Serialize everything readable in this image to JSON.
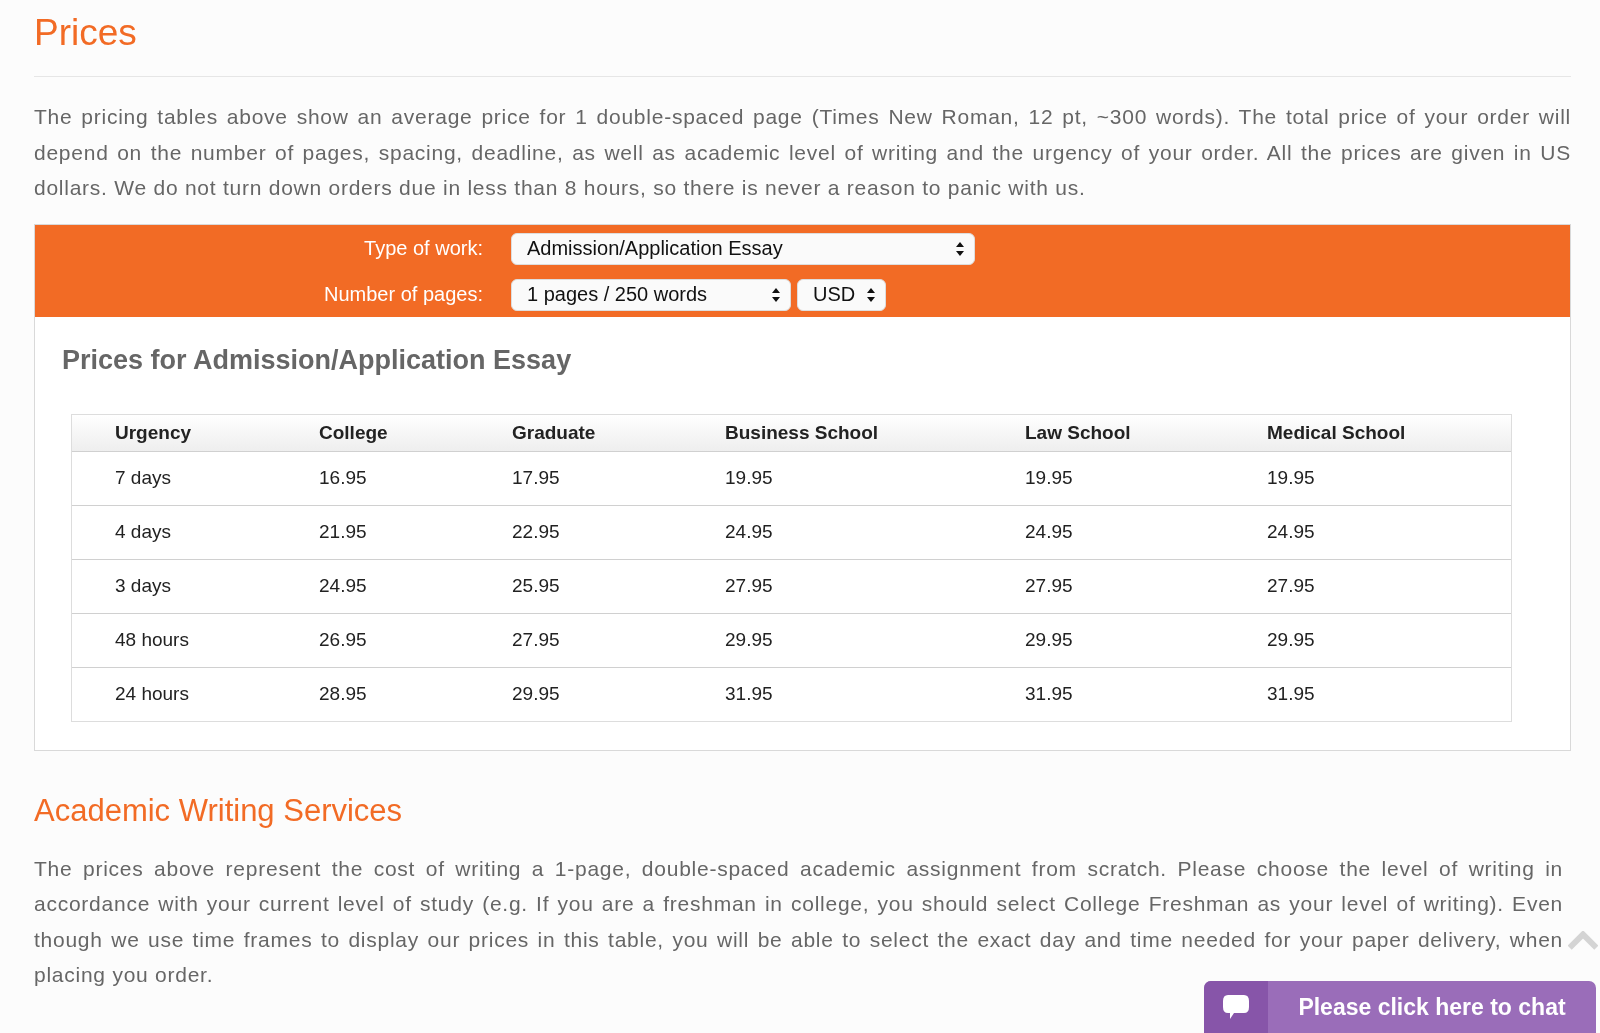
{
  "title": "Prices",
  "intro": "The pricing tables above show an average price for 1 double-spaced page (Times New Roman, 12 pt, ~300 words). The total price of your order will depend on the number of pages, spacing, deadline, as well as academic level of writing and the urgency of your order. All the prices are given in US dollars. We do not turn down orders due in less than 8 hours, so there is never a reason to panic with us.",
  "calculator": {
    "type_label": "Type of work:",
    "type_value": "Admission/Application Essay",
    "pages_label": "Number of pages:",
    "pages_value": "1 pages / 250 words",
    "currency_value": "USD"
  },
  "price_table": {
    "heading": "Prices for Admission/Application Essay",
    "columns": [
      "Urgency",
      "College",
      "Graduate",
      "Business School",
      "Law School",
      "Medical School"
    ],
    "rows": [
      [
        "7 days",
        "16.95",
        "17.95",
        "19.95",
        "19.95",
        "19.95"
      ],
      [
        "4 days",
        "21.95",
        "22.95",
        "24.95",
        "24.95",
        "24.95"
      ],
      [
        "3 days",
        "24.95",
        "25.95",
        "27.95",
        "27.95",
        "27.95"
      ],
      [
        "48 hours",
        "26.95",
        "27.95",
        "29.95",
        "29.95",
        "29.95"
      ],
      [
        "24 hours",
        "28.95",
        "29.95",
        "31.95",
        "31.95",
        "31.95"
      ]
    ]
  },
  "section_title": "Academic Writing Services",
  "section_text": "The prices above represent the cost of writing a 1-page, double-spaced academic assignment from scratch. Please choose the level of writing in accordance with your current level of study (e.g. If you are a freshman in college, you should select College Freshman as your level of writing). Even though we use time frames to display our prices in this table, you will be able to select the exact day and time needed for your paper delivery, when placing you order.",
  "chat_button": "Please click here to chat"
}
